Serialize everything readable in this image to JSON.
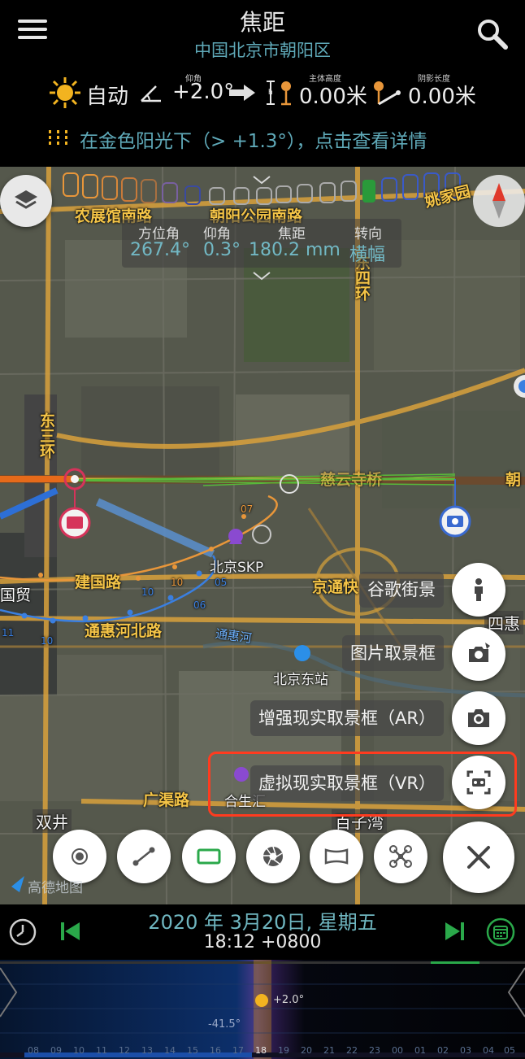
{
  "header": {
    "title": "焦距",
    "location": "中国北京市朝阳区",
    "mode_label": "自动",
    "elevation_tiny_label": "仰角",
    "elevation_value": "+2.0°",
    "subject_height_tiny_label": "主体高度",
    "subject_height_value": "0.00米",
    "shadow_length_tiny_label": "阴影长度",
    "shadow_length_value": "0.00米",
    "golden_hour_text": "在金色阳光下（> +1.3°），点击查看详情"
  },
  "readout": {
    "azimuth_label": "方位角",
    "azimuth_value": "267.4°",
    "altitude_label": "仰角",
    "altitude_value": "0.3°",
    "focal_label": "焦距",
    "focal_value": "180.2 mm",
    "orientation_label": "转向",
    "orientation_value": "横幅"
  },
  "map": {
    "road_labels": {
      "nongzhanguan": "农展馆南路",
      "chaoyang_park": "朝阳公园南路",
      "yaojiayuan": "姚家园",
      "east4ring": "东四环",
      "east3ring": "东三环",
      "jianguo": "建国路",
      "guomao": "国贸",
      "tonghui_north": "通惠河北路",
      "tonghui_river": "通惠河",
      "beijing_skp": "北京SKP",
      "jingtong": "京通快",
      "beijing_east_station": "北京东站",
      "guangqu": "广渠路",
      "hesheng": "合生汇",
      "shuangjing": "双井",
      "baiziwan": "百子湾",
      "sihui": "四惠",
      "chao": "朝",
      "cihui": "慈云寺桥"
    },
    "small_numbers": [
      "07",
      "10",
      "05",
      "06",
      "10",
      "11",
      "10"
    ],
    "amap_watermark": "高德地图"
  },
  "side_menu": {
    "street_view": "谷歌街景",
    "image_viewfinder": "图片取景框",
    "ar_viewfinder": "增强现实取景框（AR）",
    "vr_viewfinder": "虚拟现实取景框（VR）"
  },
  "timeline": {
    "date": "2020 年 3月20日, 星期五",
    "time": "18:12 +0800",
    "sun_elevation": "+2.0°",
    "moon_elevation": "-41.5°",
    "hours": [
      "08",
      "09",
      "10",
      "11",
      "12",
      "13",
      "14",
      "15",
      "16",
      "17",
      "18",
      "19",
      "20",
      "21",
      "22",
      "23",
      "00",
      "01",
      "02",
      "03",
      "04",
      "05"
    ]
  },
  "colors": {
    "accent_teal": "#5fa9b8",
    "sun_yellow": "#f2b320",
    "highlight_red": "#ff3b1f",
    "action_green": "#2aa84a"
  }
}
